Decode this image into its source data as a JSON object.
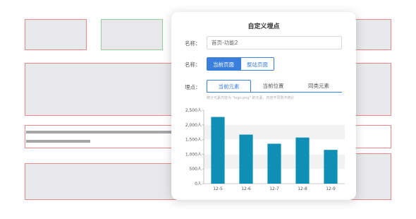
{
  "panel": {
    "title": "自定义埋点",
    "name_label": "名称：",
    "name_value": "首页-功能2",
    "scope_label": "名称：",
    "scope_options": [
      "当前页面",
      "整站页面"
    ],
    "point_label": "埋点：",
    "point_tabs": [
      "当前元素",
      "当前位置",
      "同类元素"
    ],
    "hint": "统计元素内容为 \"logo.png\" 的元素，内容不同则不统计"
  },
  "colors": {
    "accent": "#3b7fdd",
    "bar": "#0f8fb5"
  },
  "chart_data": {
    "type": "bar",
    "categories": [
      "12-5",
      "12-6",
      "12-7",
      "12-8",
      "12-9"
    ],
    "values": [
      2270,
      1670,
      1360,
      1570,
      1150
    ],
    "yticks": [
      "0人",
      "500人",
      "1,000人",
      "1,500人",
      "2,000人",
      "2,500人"
    ],
    "ylim": [
      0,
      2500
    ],
    "grid": "alternating bands"
  }
}
